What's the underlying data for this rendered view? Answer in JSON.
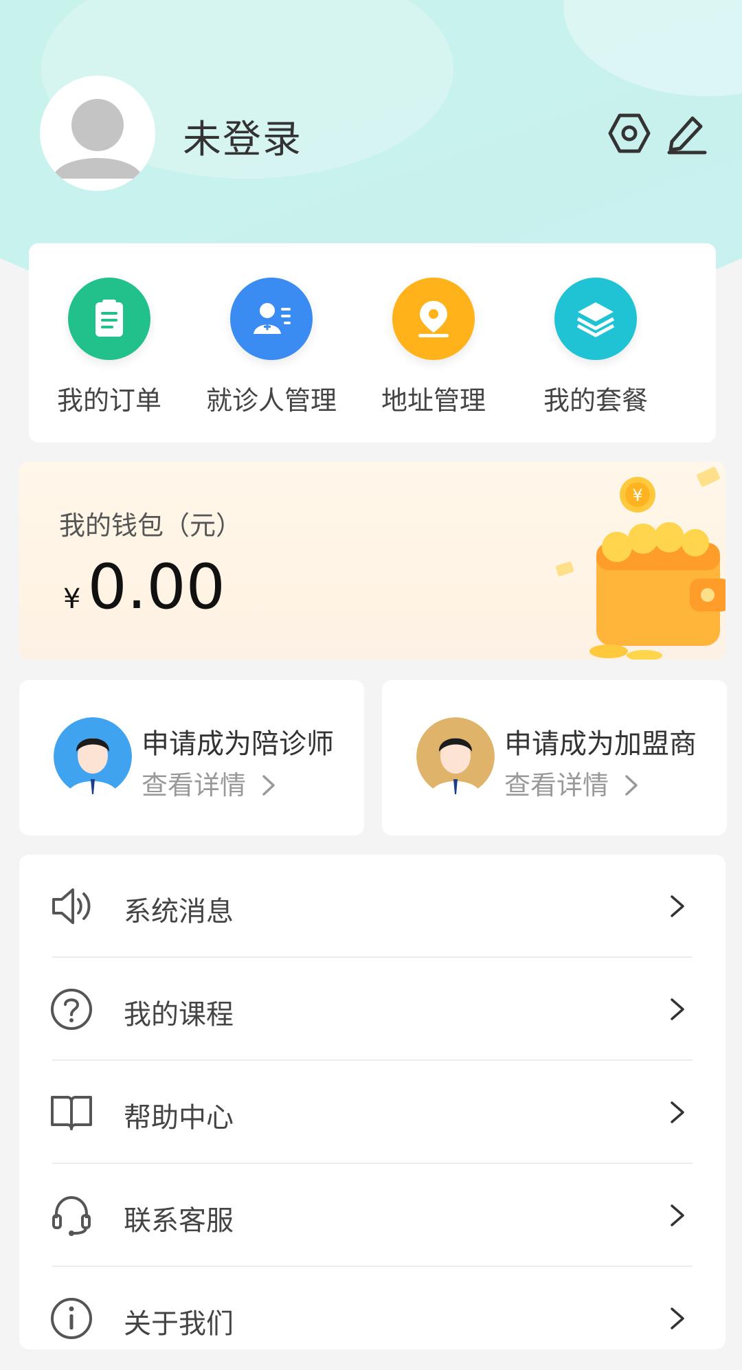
{
  "profile": {
    "name": "未登录"
  },
  "header_icons": {
    "settings_icon": "settings-hex-icon",
    "edit_icon": "edit-pen-icon"
  },
  "quick_actions": [
    {
      "label": "我的订单",
      "icon": "clipboard-icon",
      "color": "#22c08a"
    },
    {
      "label": "就诊人管理",
      "icon": "patient-icon",
      "color": "#3a8cf2"
    },
    {
      "label": "地址管理",
      "icon": "location-pin-icon",
      "color": "#ffb21a"
    },
    {
      "label": "我的套餐",
      "icon": "layers-icon",
      "color": "#1fc3d4"
    }
  ],
  "wallet": {
    "title": "我的钱包（元）",
    "currency": "¥",
    "amount": "0.00"
  },
  "apply_cards": [
    {
      "title": "申请成为陪诊师",
      "subtitle": "查看详情",
      "avatar_color": "#3fa3f0"
    },
    {
      "title": "申请成为加盟商",
      "subtitle": "查看详情",
      "avatar_color": "#e0b36a"
    }
  ],
  "menu": [
    {
      "label": "系统消息",
      "icon": "speaker-icon"
    },
    {
      "label": "我的课程",
      "icon": "question-circle-icon"
    },
    {
      "label": "帮助中心",
      "icon": "open-book-icon"
    },
    {
      "label": "联系客服",
      "icon": "headset-icon"
    },
    {
      "label": "关于我们",
      "icon": "info-circle-icon"
    }
  ]
}
